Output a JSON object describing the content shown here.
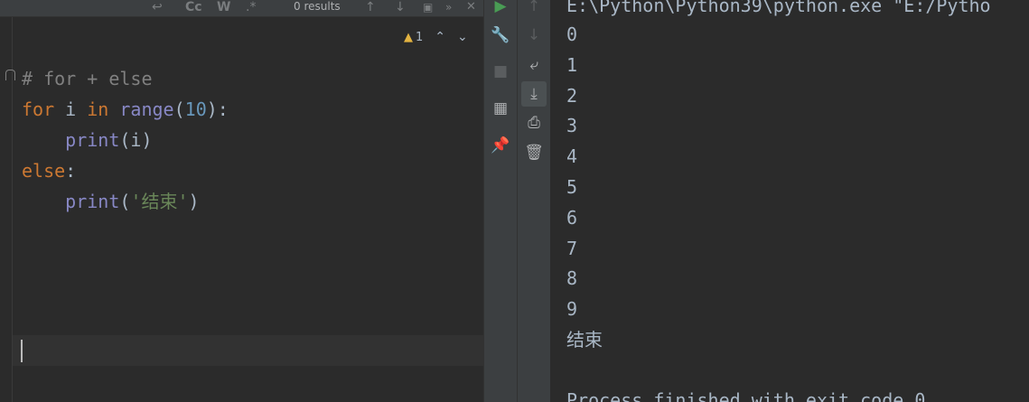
{
  "find_bar": {
    "results": "0 results",
    "icons": [
      "newline-icon",
      "match-case-icon",
      "whole-word-icon",
      "regex-icon",
      "prev-occurrence-icon",
      "next-occurrence-icon",
      "filter-icon",
      "open-in-window-icon",
      "more-icon",
      "close-icon"
    ],
    "match_case_label": "Cc",
    "whole_word_label": "W",
    "regex_label": ".*"
  },
  "inspection": {
    "warning_count": "1"
  },
  "editor": {
    "lines": [
      {
        "tokens": [
          {
            "t": "# for + else",
            "c": "cm"
          }
        ]
      },
      {
        "tokens": [
          {
            "t": "for",
            "c": "kw"
          },
          {
            "t": " i ",
            "c": ""
          },
          {
            "t": "in",
            "c": "kw"
          },
          {
            "t": " ",
            "c": ""
          },
          {
            "t": "range",
            "c": "bi"
          },
          {
            "t": "(",
            "c": ""
          },
          {
            "t": "10",
            "c": "num"
          },
          {
            "t": "):",
            "c": ""
          }
        ]
      },
      {
        "tokens": [
          {
            "t": "    ",
            "c": ""
          },
          {
            "t": "print",
            "c": "bi"
          },
          {
            "t": "(i)",
            "c": ""
          }
        ]
      },
      {
        "tokens": [
          {
            "t": "else",
            "c": "kw"
          },
          {
            "t": ":",
            "c": ""
          }
        ]
      },
      {
        "tokens": [
          {
            "t": "    ",
            "c": ""
          },
          {
            "t": "print",
            "c": "bi"
          },
          {
            "t": "(",
            "c": ""
          },
          {
            "t": "'结束'",
            "c": "str"
          },
          {
            "t": ")",
            "c": ""
          }
        ]
      }
    ]
  },
  "run_toolbar": {
    "left": [
      "run-icon",
      "wrench-icon",
      "stop-icon",
      "layout-icon",
      "pin-icon"
    ],
    "right": [
      "up-arrow-icon",
      "down-arrow-icon",
      "soft-wrap-icon",
      "scroll-to-end-icon",
      "print-icon",
      "trash-icon"
    ]
  },
  "console": {
    "command": "E:\\Python\\Python39\\python.exe \"E:/Pytho",
    "output": [
      "0",
      "1",
      "2",
      "3",
      "4",
      "5",
      "6",
      "7",
      "8",
      "9",
      "结束"
    ],
    "finish": "Process finished with exit code 0"
  },
  "colors": {
    "editor_bg": "#2b2b2b",
    "toolbar_bg": "#3c3f41",
    "keyword": "#cc7832",
    "builtin": "#8888c6",
    "number": "#6897bb",
    "string": "#6a8759",
    "comment": "#808080",
    "run_green": "#499c54",
    "warning": "#e3b341"
  }
}
